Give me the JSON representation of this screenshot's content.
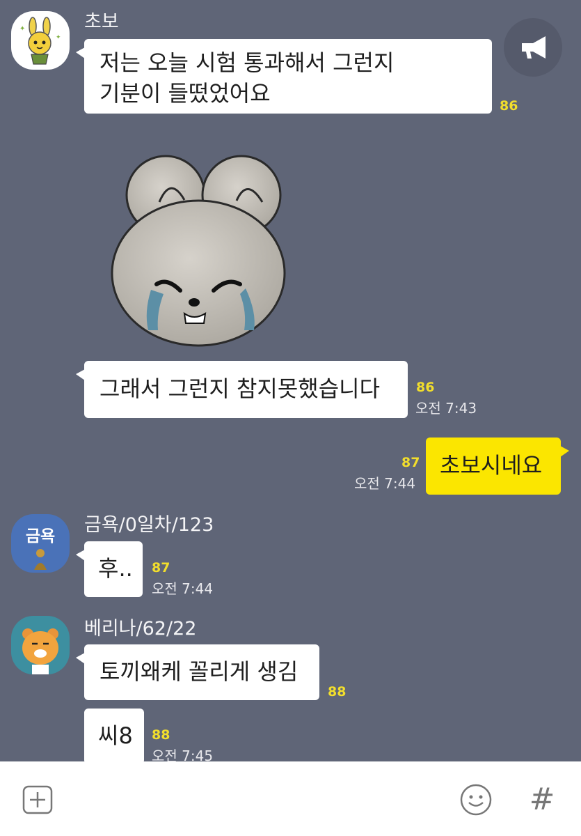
{
  "messages": [
    {
      "sender": "초보",
      "lines": [
        "저는 오늘 시험 통과해서 그런지",
        "기분이 들떴었어요"
      ],
      "count": "86"
    },
    {
      "sender": "초보",
      "text": "그래서 그런지 참지못했습니다",
      "count": "86",
      "time": "오전 7:43"
    },
    {
      "sender": "me",
      "text": "초보시네요",
      "count": "87",
      "time": "오전 7:44"
    },
    {
      "sender": "금욕/0일차/123",
      "avatar_text": "금욕",
      "text": "후..",
      "count": "87",
      "time": "오전 7:44"
    },
    {
      "sender": "베리나/62/22",
      "text": "토끼왜케 꼴리게 생김",
      "count": "88"
    },
    {
      "sender": "베리나/62/22",
      "text": "씨8",
      "count": "88",
      "time": "오전 7:45"
    }
  ],
  "icons": {
    "announce": "megaphone-icon",
    "add": "plus-icon",
    "emoji": "smiley-icon",
    "hashtag": "hash-icon"
  },
  "hashtag_glyph": "#",
  "colors": {
    "background": "#5f6577",
    "my_bubble": "#fbe600",
    "other_bubble": "#ffffff",
    "unread_count": "#f2de2c"
  }
}
